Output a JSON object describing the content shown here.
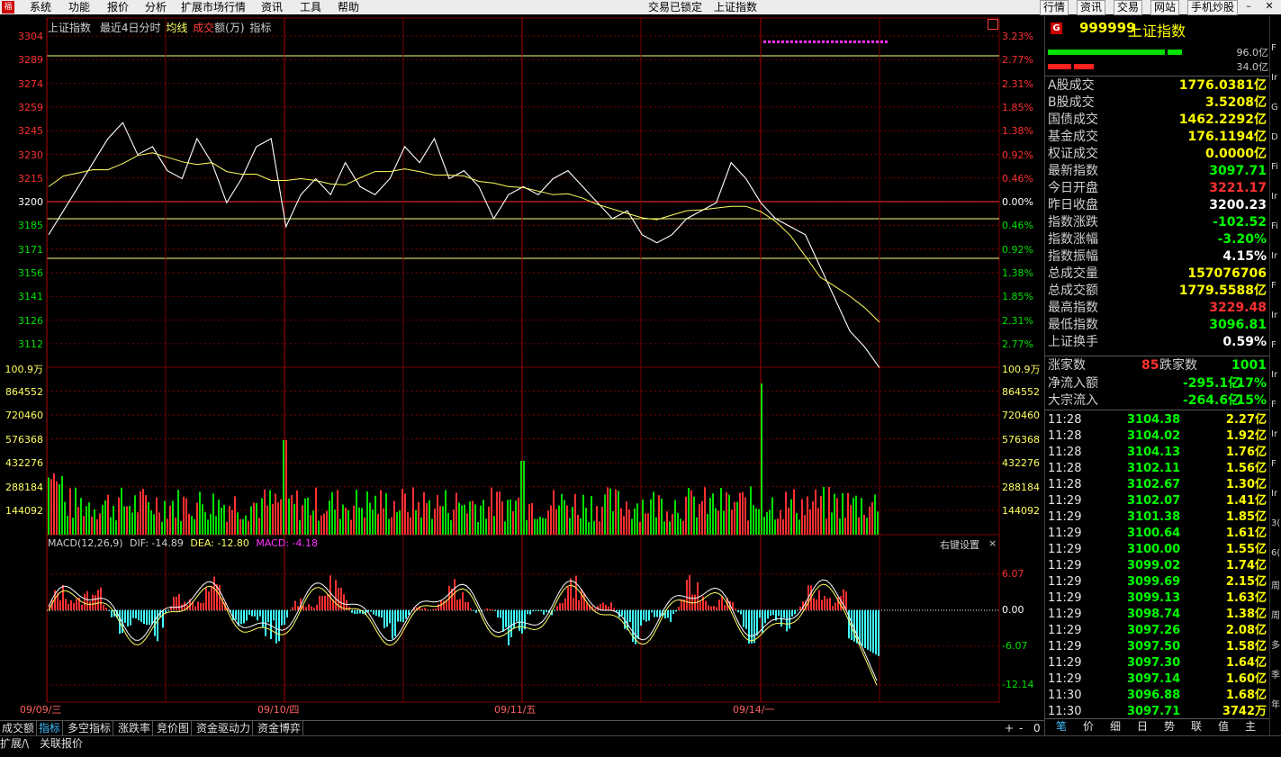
{
  "menu": {
    "items": [
      "系统",
      "功能",
      "报价",
      "分析",
      "扩展市场行情",
      "资讯",
      "工具",
      "帮助"
    ],
    "center_status": "交易已锁定",
    "center_title": "上证指数",
    "right_buttons": [
      "行情",
      "资讯",
      "交易",
      "网站",
      "手机炒股"
    ]
  },
  "chart": {
    "header": {
      "name": "上证指数",
      "period": "最近4日分时",
      "avg": "均线",
      "vol_a": "成交",
      "vol_b": "额(万)",
      "ind": "指标"
    },
    "left_axis": [
      "3304",
      "3289",
      "3274",
      "3259",
      "3245",
      "3230",
      "3215",
      "3200",
      "3185",
      "3171",
      "3156",
      "3141",
      "3126",
      "3112"
    ],
    "right_axis": [
      "3.23%",
      "2.77%",
      "2.31%",
      "1.85%",
      "1.38%",
      "0.92%",
      "0.46%",
      "0.00%",
      "0.46%",
      "0.92%",
      "1.38%",
      "1.85%",
      "2.31%",
      "2.77%"
    ],
    "vol_axis": [
      "100.9万",
      "864552",
      "720460",
      "576368",
      "432276",
      "288184",
      "144092"
    ],
    "macd_header": {
      "name": "MACD(12,26,9)",
      "dif": "DIF: -14.89",
      "dea": "DEA: -12.80",
      "macd": "MACD: -4.18"
    },
    "macd_axis": [
      "6.07",
      "0.00",
      "-6.07",
      "-12.14"
    ],
    "macd_settings": "右键设置",
    "dates": [
      "09/09/三",
      "09/10/四",
      "09/11/五",
      "09/14/一"
    ],
    "colors": {
      "up": "#ff3030",
      "down": "#00e000",
      "grid": "#7a0000",
      "price": "#ffffff",
      "avg": "#ffff60",
      "cyan": "#40ffff",
      "magenta": "#ff30ff"
    }
  },
  "chart_data": {
    "type": "line",
    "title": "上证指数",
    "subtitle": "最近4日分时",
    "prev_close": 3200.23,
    "ylim": [
      3097,
      3304
    ],
    "x": [
      "09/09/三",
      "09/10/四",
      "09/11/五",
      "09/14/一"
    ],
    "series": [
      {
        "values_sampled": [
          3180,
          3195,
          3210,
          3225,
          3240,
          3250,
          3230,
          3235,
          3220,
          3215,
          3240,
          3225,
          3200,
          3215,
          3235,
          3240,
          3185,
          3205,
          3215,
          3205,
          3225,
          3210,
          3205,
          3215,
          3235,
          3225,
          3240,
          3215,
          3220,
          3210,
          3190,
          3205,
          3210,
          3205,
          3215,
          3220,
          3210,
          3200,
          3190,
          3195,
          3180,
          3175,
          3180,
          3190,
          3195,
          3200,
          3225,
          3215,
          3200,
          3190,
          3185,
          3180,
          3160,
          3140,
          3120,
          3110,
          3097
        ]
      }
    ]
  },
  "right": {
    "code": "999999",
    "name": "上证指数",
    "bar1_val": "96.0亿",
    "bar2_val": "34.0亿",
    "stats": [
      {
        "label": "A股成交",
        "value": "1776.0381亿",
        "color": "#ffff00"
      },
      {
        "label": "B股成交",
        "value": "3.5208亿",
        "color": "#ffff00"
      },
      {
        "label": "国债成交",
        "value": "1462.2292亿",
        "color": "#ffff00"
      },
      {
        "label": "基金成交",
        "value": "176.1194亿",
        "color": "#ffff00"
      },
      {
        "label": "权证成交",
        "value": "0.0000亿",
        "color": "#ffff00"
      },
      {
        "label": "最新指数",
        "value": "3097.71",
        "color": "#00ff00"
      },
      {
        "label": "今日开盘",
        "value": "3221.17",
        "color": "#ff3030"
      },
      {
        "label": "昨日收盘",
        "value": "3200.23",
        "color": "#ffffff"
      },
      {
        "label": "指数涨跌",
        "value": "-102.52",
        "color": "#00ff00"
      },
      {
        "label": "指数涨幅",
        "value": "-3.20%",
        "color": "#00ff00"
      },
      {
        "label": "指数振幅",
        "value": "4.15%",
        "color": "#ffffff"
      },
      {
        "label": "总成交量",
        "value": "157076706",
        "color": "#ffff00"
      },
      {
        "label": "总成交额",
        "value": "1779.5588亿",
        "color": "#ffff00"
      },
      {
        "label": "最高指数",
        "value": "3229.48",
        "color": "#ff3030"
      },
      {
        "label": "最低指数",
        "value": "3096.81",
        "color": "#00ff00"
      },
      {
        "label": "上证换手",
        "value": "0.59%",
        "color": "#ffffff"
      }
    ],
    "rise_label": "涨家数",
    "rise_value": "85",
    "fall_label": "跌家数",
    "fall_value": "1001",
    "flow": [
      {
        "label": "净流入额",
        "value": "-295.1亿",
        "pct": "-17%"
      },
      {
        "label": "大宗流入",
        "value": "-264.6亿",
        "pct": "-15%"
      }
    ],
    "ticks": [
      {
        "t": "11:28",
        "p": "3104.38",
        "v": "2.27亿"
      },
      {
        "t": "11:28",
        "p": "3104.02",
        "v": "1.92亿"
      },
      {
        "t": "11:28",
        "p": "3104.13",
        "v": "1.76亿"
      },
      {
        "t": "11:28",
        "p": "3102.11",
        "v": "1.56亿"
      },
      {
        "t": "11:28",
        "p": "3102.67",
        "v": "1.30亿"
      },
      {
        "t": "11:29",
        "p": "3102.07",
        "v": "1.41亿"
      },
      {
        "t": "11:29",
        "p": "3101.38",
        "v": "1.85亿"
      },
      {
        "t": "11:29",
        "p": "3100.64",
        "v": "1.61亿"
      },
      {
        "t": "11:29",
        "p": "3100.00",
        "v": "1.55亿"
      },
      {
        "t": "11:29",
        "p": "3099.02",
        "v": "1.74亿"
      },
      {
        "t": "11:29",
        "p": "3099.69",
        "v": "2.15亿"
      },
      {
        "t": "11:29",
        "p": "3099.13",
        "v": "1.63亿"
      },
      {
        "t": "11:29",
        "p": "3098.74",
        "v": "1.38亿"
      },
      {
        "t": "11:29",
        "p": "3097.26",
        "v": "2.08亿"
      },
      {
        "t": "11:29",
        "p": "3097.50",
        "v": "1.58亿"
      },
      {
        "t": "11:29",
        "p": "3097.30",
        "v": "1.64亿"
      },
      {
        "t": "11:29",
        "p": "3097.14",
        "v": "1.60亿"
      },
      {
        "t": "11:30",
        "p": "3096.88",
        "v": "1.68亿"
      },
      {
        "t": "11:30",
        "p": "3097.71",
        "v": "3742万"
      }
    ],
    "bottom_tabs": [
      "笔",
      "价",
      "细",
      "日",
      "势",
      "联",
      "值",
      "主"
    ]
  },
  "bottom": {
    "tabs": [
      "成交额",
      "指标",
      "多空指标",
      "涨跌率",
      "竞价图",
      "资金驱动力",
      "资金博弈"
    ],
    "row2": [
      "扩展/\\",
      "关联报价"
    ],
    "controls": [
      "+",
      "-",
      "0"
    ]
  },
  "edge_letters": [
    "F",
    "Ir",
    "G",
    "D",
    "Fi",
    "Ir",
    "Fi",
    "Ir",
    "F",
    "Ir",
    "F",
    "Ir",
    "F",
    "Ir",
    "F",
    "Ir",
    "3(",
    "6(",
    "周",
    "周",
    "多",
    "季",
    "年"
  ]
}
